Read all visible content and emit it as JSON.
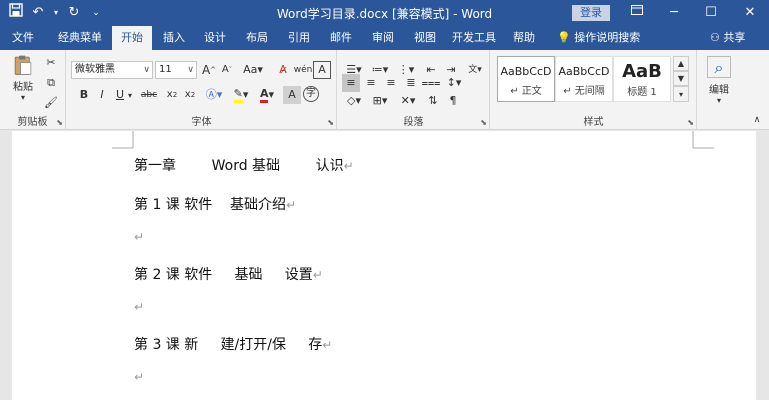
{
  "titlebar": {
    "title": "Word学习目录.docx [兼容模式] - Word",
    "login": "登录"
  },
  "tabs": {
    "items": [
      "文件",
      "经典菜单",
      "开始",
      "插入",
      "设计",
      "布局",
      "引用",
      "邮件",
      "审阅",
      "视图",
      "开发工具",
      "帮助"
    ],
    "search": "操作说明搜索",
    "share": "共享"
  },
  "ribbon": {
    "clipboard": {
      "paste": "粘贴",
      "label": "剪贴板"
    },
    "font": {
      "name": "微软雅黑",
      "size": "11",
      "label": "字体"
    },
    "paragraph": {
      "label": "段落"
    },
    "styles": {
      "items": [
        {
          "sample": "AaBbCcD",
          "name": "↵ 正文"
        },
        {
          "sample": "AaBbCcD",
          "name": "↵ 无间隔"
        },
        {
          "sample": "AaB",
          "name": "标题 1"
        }
      ],
      "label": "样式"
    },
    "editing": {
      "label": "编辑"
    }
  },
  "document": {
    "lines": [
      "第一章        Word 基础        认识",
      "第 1 课 软件    基础介绍",
      "",
      "第 2 课 软件     基础     设置",
      "",
      "第 3 课 新     建/打开/保     存",
      ""
    ],
    "para_mark": "↵"
  }
}
